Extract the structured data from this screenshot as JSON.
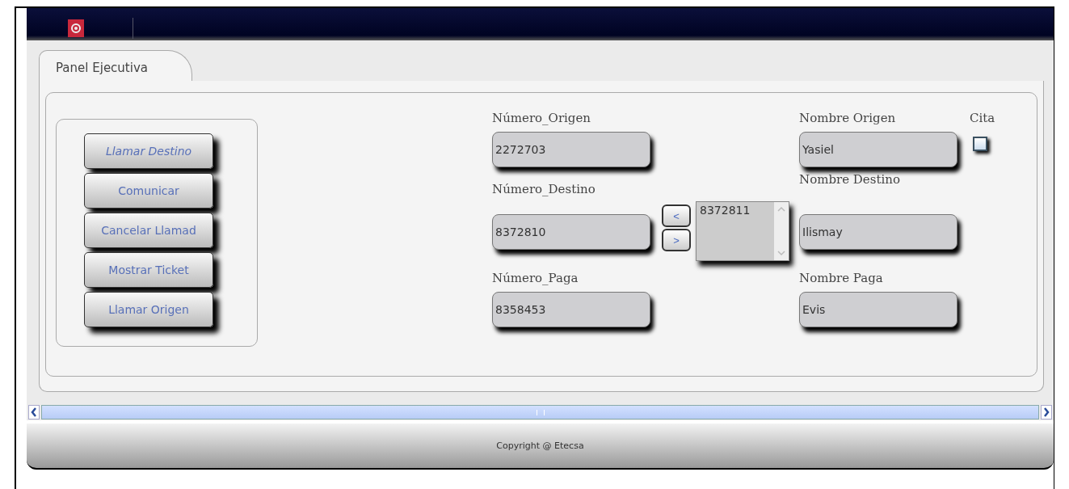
{
  "tab": {
    "label": "Panel Ejecutiva",
    "selected": true
  },
  "actions": [
    {
      "label": "Llamar Destino",
      "focused": true
    },
    {
      "label": "Comunicar",
      "focused": false
    },
    {
      "label": "Cancelar Llamad",
      "focused": false
    },
    {
      "label": "Mostrar Ticket",
      "focused": false
    },
    {
      "label": "Llamar Origen",
      "focused": false
    }
  ],
  "number_fields": [
    {
      "label": "Número_Origen",
      "value": "2272703"
    },
    {
      "label": "Número_Destino",
      "value": "8372810"
    },
    {
      "label": "Número_Paga",
      "value": "8358453"
    }
  ],
  "move_buttons": [
    "<",
    ">"
  ],
  "destino_list": {
    "items": [
      "8372811"
    ]
  },
  "name_fields": [
    {
      "label": "Nombre Origen",
      "value": "Yasiel"
    },
    {
      "label": "Nombre Destino",
      "value": "Ilismay"
    },
    {
      "label": "Nombre Paga",
      "value": "Evis"
    }
  ],
  "cita": {
    "label": "Cita",
    "checked": false
  },
  "footer": "Copyright @ Etecsa"
}
